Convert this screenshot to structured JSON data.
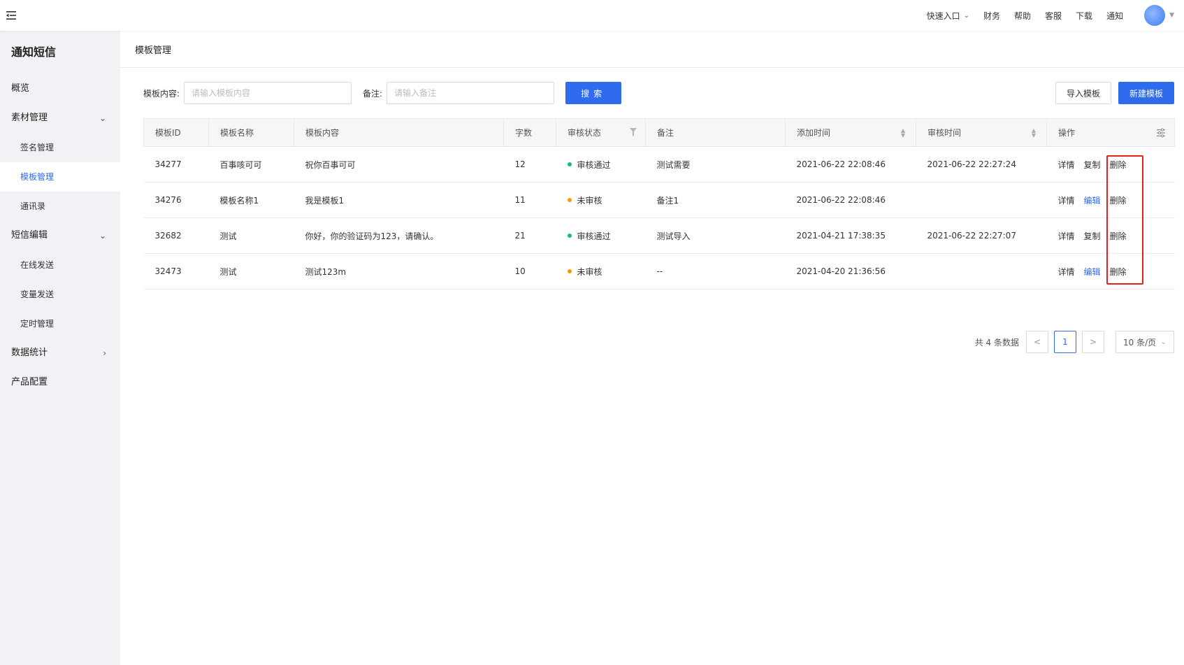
{
  "header": {
    "nav": [
      {
        "label": "快速入口",
        "has_dropdown": true
      },
      {
        "label": "财务"
      },
      {
        "label": "帮助"
      },
      {
        "label": "客服"
      },
      {
        "label": "下载"
      },
      {
        "label": "通知"
      }
    ],
    "icons": {
      "menu": "menu-fold-icon",
      "avatar": "avatar"
    }
  },
  "sidebar": {
    "title": "通知短信",
    "items": [
      {
        "label": "概览"
      },
      {
        "label": "素材管理",
        "expanded": true
      },
      {
        "label": "签名管理"
      },
      {
        "label": "模板管理",
        "active": true
      },
      {
        "label": "通讯录"
      },
      {
        "label": "短信编辑",
        "expanded": true
      },
      {
        "label": "在线发送"
      },
      {
        "label": "变量发送"
      },
      {
        "label": "定时管理"
      },
      {
        "label": "数据统计",
        "expanded": false
      },
      {
        "label": "产品配置"
      }
    ]
  },
  "page": {
    "breadcrumb": "模板管理"
  },
  "filters": {
    "content_label": "模板内容:",
    "content_placeholder": "请输入模板内容",
    "remark_label": "备注:",
    "remark_placeholder": "请输入备注",
    "search_button": "搜索",
    "import_button": "导入模板",
    "new_button": "新建模板"
  },
  "table": {
    "columns": [
      "模板ID",
      "模板名称",
      "模板内容",
      "字数",
      "审核状态",
      "备注",
      "添加时间",
      "审核时间",
      "操作"
    ],
    "rows": [
      {
        "id": "34277",
        "name": "百事咳可可",
        "content": "祝你百事可可",
        "count": "12",
        "status": "审核通过",
        "status_color": "#19be6b",
        "remark": "测试需要",
        "added": "2021-06-22 22:08:46",
        "reviewed": "2021-06-22 22:27:24",
        "ops": [
          "详情",
          "复制",
          "删除"
        ]
      },
      {
        "id": "34276",
        "name": "模板名称1",
        "content": "我是模板1",
        "count": "11",
        "status": "未审核",
        "status_color": "#ff9900",
        "remark": "备注1",
        "added": "2021-06-22 22:08:46",
        "reviewed": "",
        "ops": [
          "详情",
          "编辑",
          "删除"
        ]
      },
      {
        "id": "32682",
        "name": "测试",
        "content": "你好，你的验证码为123，请确认。",
        "count": "21",
        "status": "审核通过",
        "status_color": "#19be6b",
        "remark": "测试导入",
        "added": "2021-04-21 17:38:35",
        "reviewed": "2021-06-22 22:27:07",
        "ops": [
          "详情",
          "复制",
          "删除"
        ]
      },
      {
        "id": "32473",
        "name": "测试",
        "content": "测试123m",
        "count": "10",
        "status": "未审核",
        "status_color": "#ff9900",
        "remark": "--",
        "added": "2021-04-20 21:36:56",
        "reviewed": "",
        "ops": [
          "详情",
          "编辑",
          "删除"
        ]
      }
    ]
  },
  "pagination": {
    "total": "共 4 条数据",
    "current": "1",
    "prev": "<",
    "next": ">",
    "page_size": "10 条/页"
  },
  "colors": {
    "primary": "#2f6bed",
    "highlight": "#e1251b"
  }
}
